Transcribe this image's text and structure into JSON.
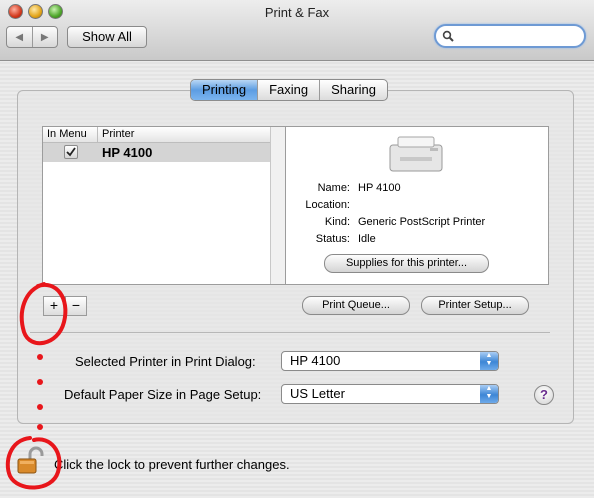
{
  "window": {
    "title": "Print & Fax"
  },
  "toolbar": {
    "back_icon": "back-arrow-icon",
    "forward_icon": "forward-arrow-icon",
    "show_all_label": "Show All",
    "search": {
      "value": "",
      "placeholder": ""
    }
  },
  "tabs": [
    {
      "label": "Printing",
      "active": true
    },
    {
      "label": "Faxing",
      "active": false
    },
    {
      "label": "Sharing",
      "active": false
    }
  ],
  "printer_list": {
    "columns": [
      "In Menu",
      "Printer"
    ],
    "rows": [
      {
        "in_menu": true,
        "name": "HP 4100",
        "selected": true
      }
    ]
  },
  "printer_info": {
    "fields": [
      {
        "label": "Name:",
        "value": "HP 4100"
      },
      {
        "label": "Location:",
        "value": ""
      },
      {
        "label": "Kind:",
        "value": "Generic PostScript Printer"
      },
      {
        "label": "Status:",
        "value": "Idle"
      }
    ],
    "supplies_button": "Supplies for this printer..."
  },
  "list_controls": {
    "add": "+",
    "remove": "−"
  },
  "actions": {
    "print_queue": "Print Queue...",
    "printer_setup": "Printer Setup..."
  },
  "settings": {
    "selected_printer": {
      "label": "Selected Printer in Print Dialog:",
      "value": "HP 4100"
    },
    "paper_size": {
      "label": "Default Paper Size in Page Setup:",
      "value": "US Letter"
    }
  },
  "help_label": "?",
  "lock": {
    "message": "Click the lock to prevent further changes.",
    "icon": "unlocked-padlock-icon"
  },
  "annotation_color": "#e8161b"
}
